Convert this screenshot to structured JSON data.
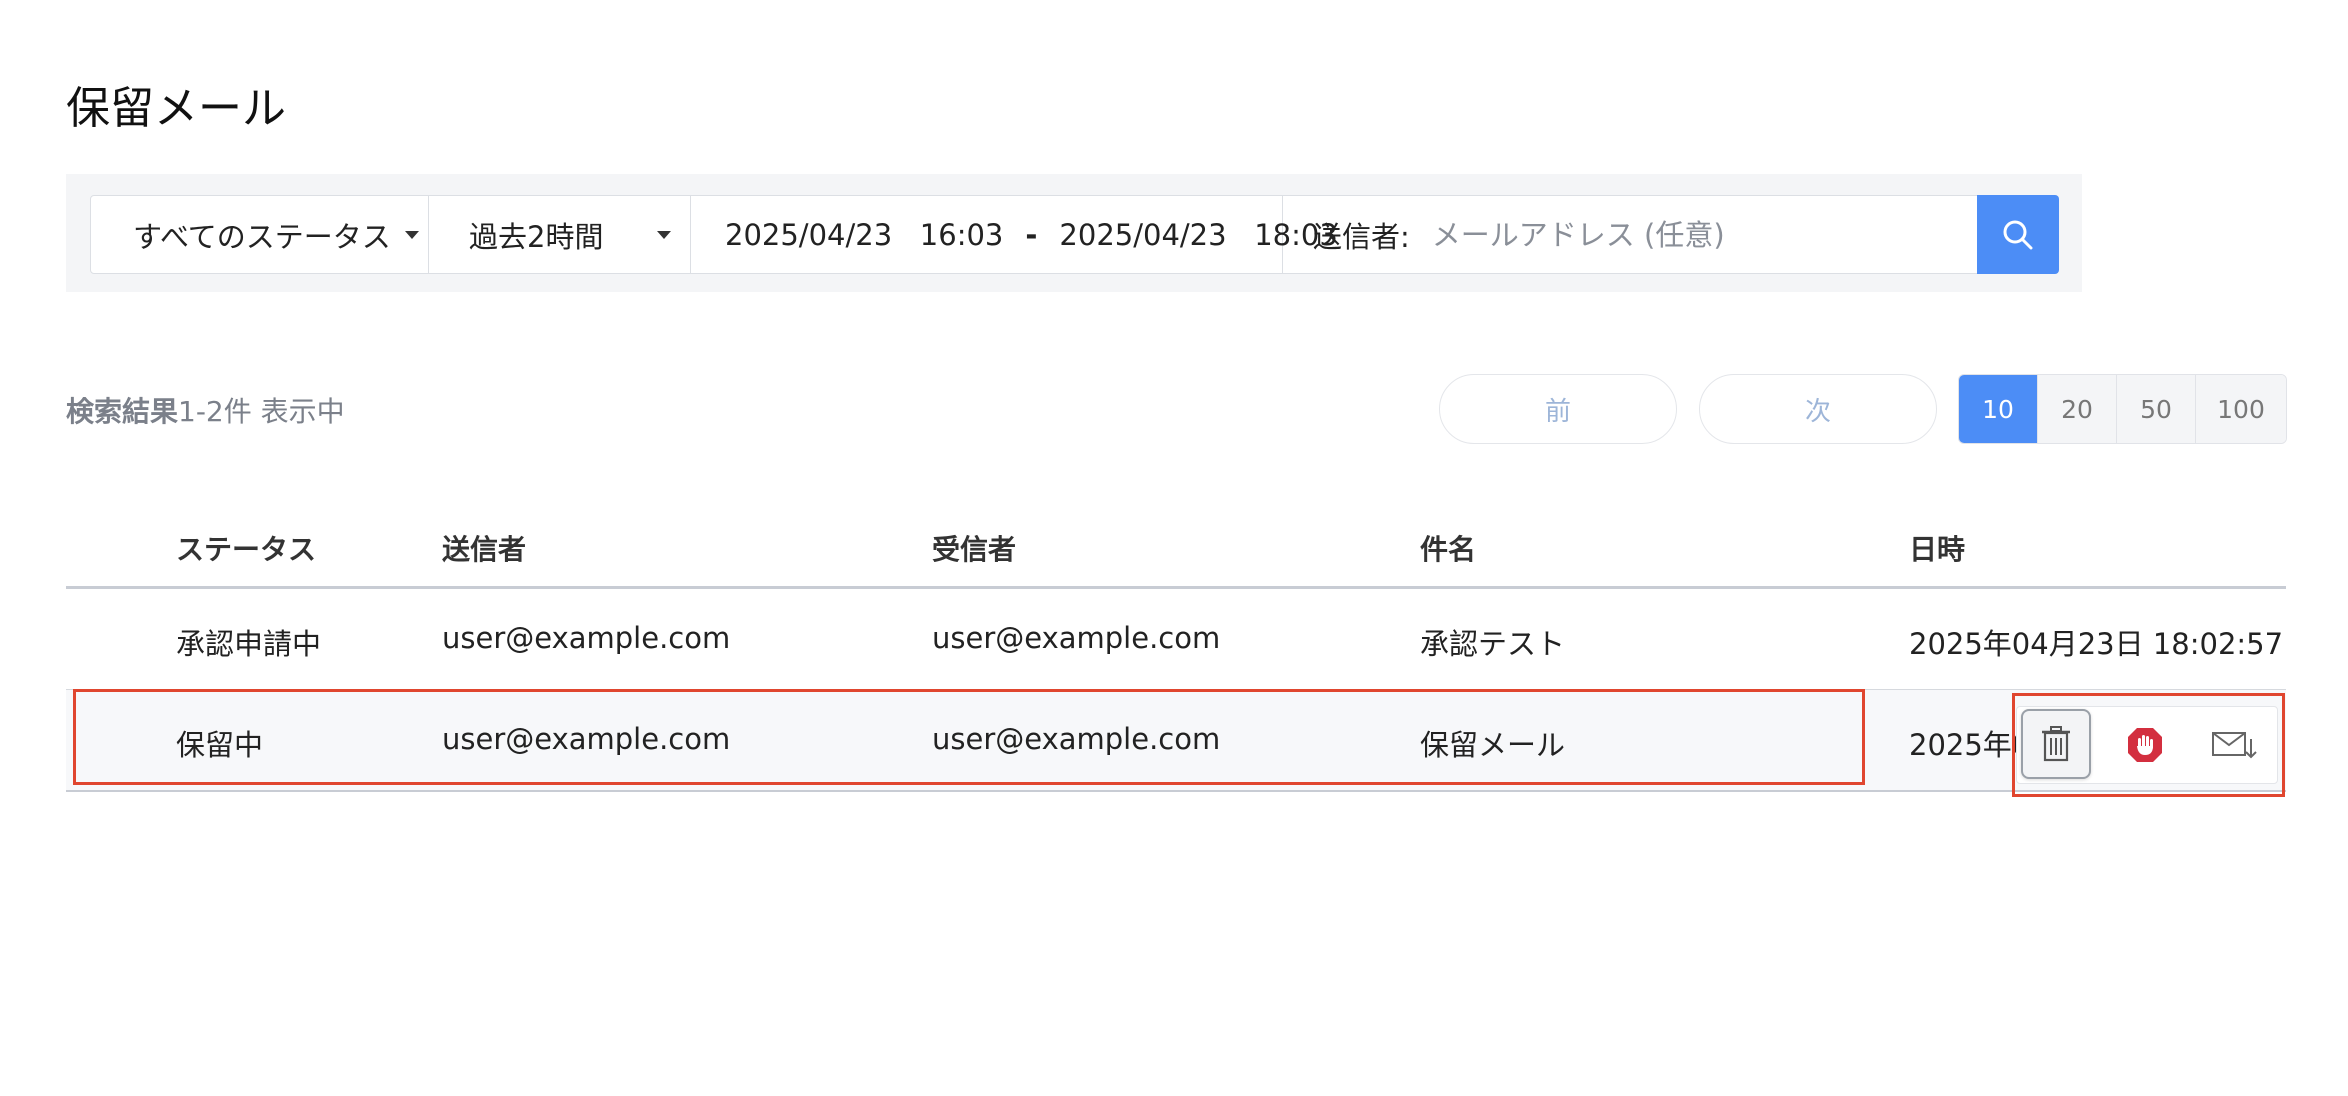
{
  "page": {
    "title": "保留メール"
  },
  "filters": {
    "status": "すべてのステータス",
    "period": "過去2時間",
    "date_from": "2025/04/23   16:03",
    "date_separator": "-",
    "date_to": "2025/04/23   18:03",
    "sender_label": "送信者:",
    "sender_placeholder": "メールアドレス (任意)"
  },
  "results": {
    "label_strong": "検索結果",
    "label_rest": "1-2件 表示中"
  },
  "pagination": {
    "prev": "前",
    "next": "次",
    "page_sizes": [
      "10",
      "20",
      "50",
      "100"
    ],
    "active_size": "10"
  },
  "table": {
    "headers": {
      "status": "ステータス",
      "sender": "送信者",
      "recipient": "受信者",
      "subject": "件名",
      "datetime": "日時"
    },
    "rows": [
      {
        "status": "承認申請中",
        "sender": "user@example.com",
        "recipient": "user@example.com",
        "subject": "承認テスト",
        "datetime": "2025年04月23日 18:02:57"
      },
      {
        "status": "保留中",
        "sender": "user@example.com",
        "recipient": "user@example.com",
        "subject": "保留メール",
        "datetime": "2025年0"
      }
    ]
  },
  "row_actions": {
    "icons": [
      "trash-icon",
      "hold-hand-icon",
      "mail-release-icon"
    ]
  },
  "colors": {
    "accent": "#4c8df6",
    "highlight": "#e0462f",
    "hold_icon": "#d32f3f"
  }
}
